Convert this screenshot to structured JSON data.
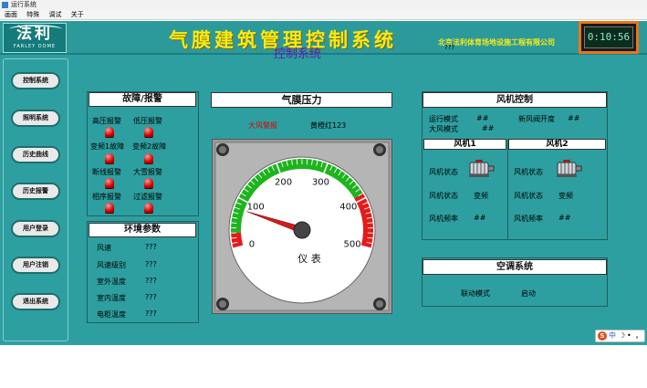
{
  "window": {
    "title": "运行系统"
  },
  "menu": [
    "画面",
    "特殊",
    "调试",
    "关于"
  ],
  "header": {
    "logo_cn": "法利",
    "logo_en": "FARLEY DOME",
    "title": "气膜建筑管理控制系统",
    "company": "北京法利体育场地设施工程有限公司",
    "clock": "0:10:56"
  },
  "sidebar": {
    "items": [
      {
        "label": "控制系统"
      },
      {
        "label": "照明系统"
      },
      {
        "label": "历史曲线"
      },
      {
        "label": "历史报警"
      },
      {
        "label": "用户登录"
      },
      {
        "label": "用户注销"
      },
      {
        "label": "退出系统"
      }
    ]
  },
  "page": {
    "title": "控制系统",
    "unknown": "???"
  },
  "faults": {
    "title": "故障/报警",
    "items": [
      {
        "label": "高压报警"
      },
      {
        "label": "低压报警"
      },
      {
        "label": "变频1故障"
      },
      {
        "label": "变频2故障"
      },
      {
        "label": "断线报警"
      },
      {
        "label": "大雪报警"
      },
      {
        "label": "相序报警"
      },
      {
        "label": "过滤报警"
      }
    ]
  },
  "env": {
    "title": "环境参数",
    "rows": [
      {
        "label": "风速",
        "value": "???"
      },
      {
        "label": "风速级别",
        "value": "???"
      },
      {
        "label": "室外温度",
        "value": "???"
      },
      {
        "label": "室内温度",
        "value": "???"
      },
      {
        "label": "电柜温度",
        "value": "???"
      }
    ]
  },
  "pressure": {
    "title": "气膜压力",
    "alarm": "大风警报",
    "alarm_detail": "黄橙红123",
    "gauge_label": "仪 表",
    "ticks": [
      "0",
      "100",
      "200",
      "300",
      "400",
      "500"
    ],
    "value": 80,
    "min": 0,
    "max": 500
  },
  "fan": {
    "title": "风机控制",
    "run_mode_label": "运行模式",
    "run_mode_value": "##",
    "wind_mode_label": "大风模式",
    "wind_mode_value": "##",
    "fresh_air_label": "新风阀开度",
    "fresh_air_value": "##",
    "fans": [
      {
        "title": "风机1",
        "status_label": "风机状态",
        "status2_label": "风机状态",
        "status2_value": "变频",
        "freq_label": "风机频率",
        "freq_value": "##"
      },
      {
        "title": "风机2",
        "status_label": "风机状态",
        "status2_label": "风机状态",
        "status2_value": "变频",
        "freq_label": "风机频率",
        "freq_value": "##"
      }
    ]
  },
  "ac": {
    "title": "空调系统",
    "mode_label": "联动模式",
    "mode_value": "启动"
  },
  "ime": {
    "brand": "S",
    "lang": "中",
    "moon": "☽",
    "punct": "•",
    "mode": "，"
  },
  "colors": {
    "background": "#2e9fa0",
    "title_yellow": "#f5ea1a",
    "clock_border": "#e8751a",
    "lamp_red": "#d40000",
    "gauge_green": "#1db41d",
    "gauge_red": "#e51a1a",
    "page_title_purple": "#5c1aa8"
  }
}
